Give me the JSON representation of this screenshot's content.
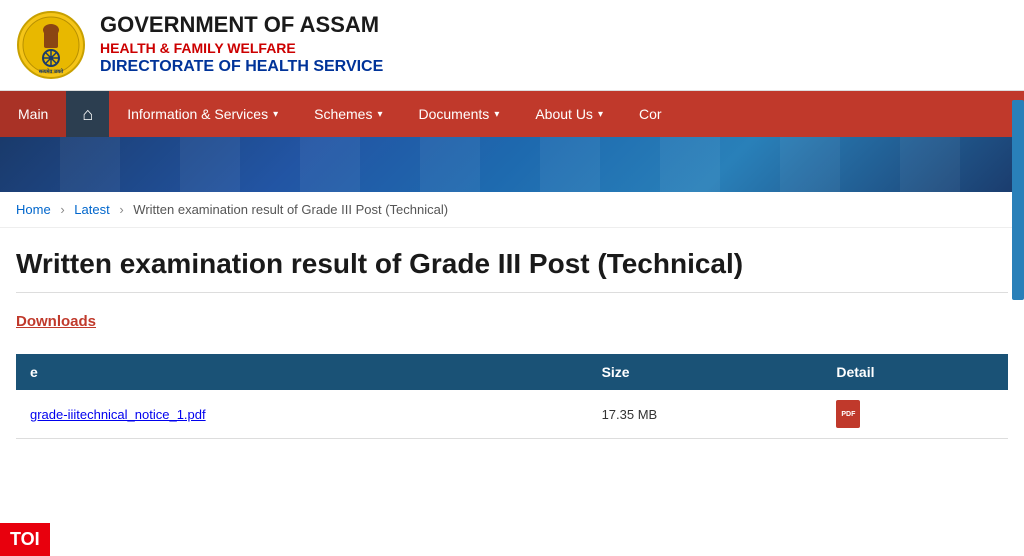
{
  "header": {
    "gov_title": "GOVERNMENT OF ASSAM",
    "health_subtitle": "HEALTH & FAMILY WELFARE",
    "directorate": "DIRECTORATE OF HEALTH SERVICE"
  },
  "navbar": {
    "items": [
      {
        "id": "main",
        "label": "Main",
        "active": true,
        "has_arrow": false,
        "is_home": false
      },
      {
        "id": "home",
        "label": "",
        "active": false,
        "has_arrow": false,
        "is_home": true
      },
      {
        "id": "info",
        "label": "Information & Services",
        "active": false,
        "has_arrow": true,
        "is_home": false
      },
      {
        "id": "schemes",
        "label": "Schemes",
        "active": false,
        "has_arrow": true,
        "is_home": false
      },
      {
        "id": "documents",
        "label": "Documents",
        "active": false,
        "has_arrow": true,
        "is_home": false
      },
      {
        "id": "about",
        "label": "About Us",
        "active": false,
        "has_arrow": true,
        "is_home": false
      },
      {
        "id": "contact",
        "label": "Cor",
        "active": false,
        "has_arrow": false,
        "is_home": false
      }
    ]
  },
  "breadcrumb": {
    "items": [
      {
        "label": "Home",
        "link": true
      },
      {
        "label": "Latest",
        "link": true
      },
      {
        "label": "Written examination result of Grade III Post (Technical)",
        "link": false
      }
    ]
  },
  "page": {
    "title": "Written examination result of Grade III Post (Technical)",
    "downloads_label": "Downloads"
  },
  "table": {
    "headers": [
      "e",
      "Size",
      "Detail"
    ],
    "rows": [
      {
        "filename": "grade-iiitechnical_notice_1.pdf",
        "size": "17.35 MB",
        "has_pdf": true
      }
    ]
  },
  "toi": {
    "label": "TOI"
  }
}
